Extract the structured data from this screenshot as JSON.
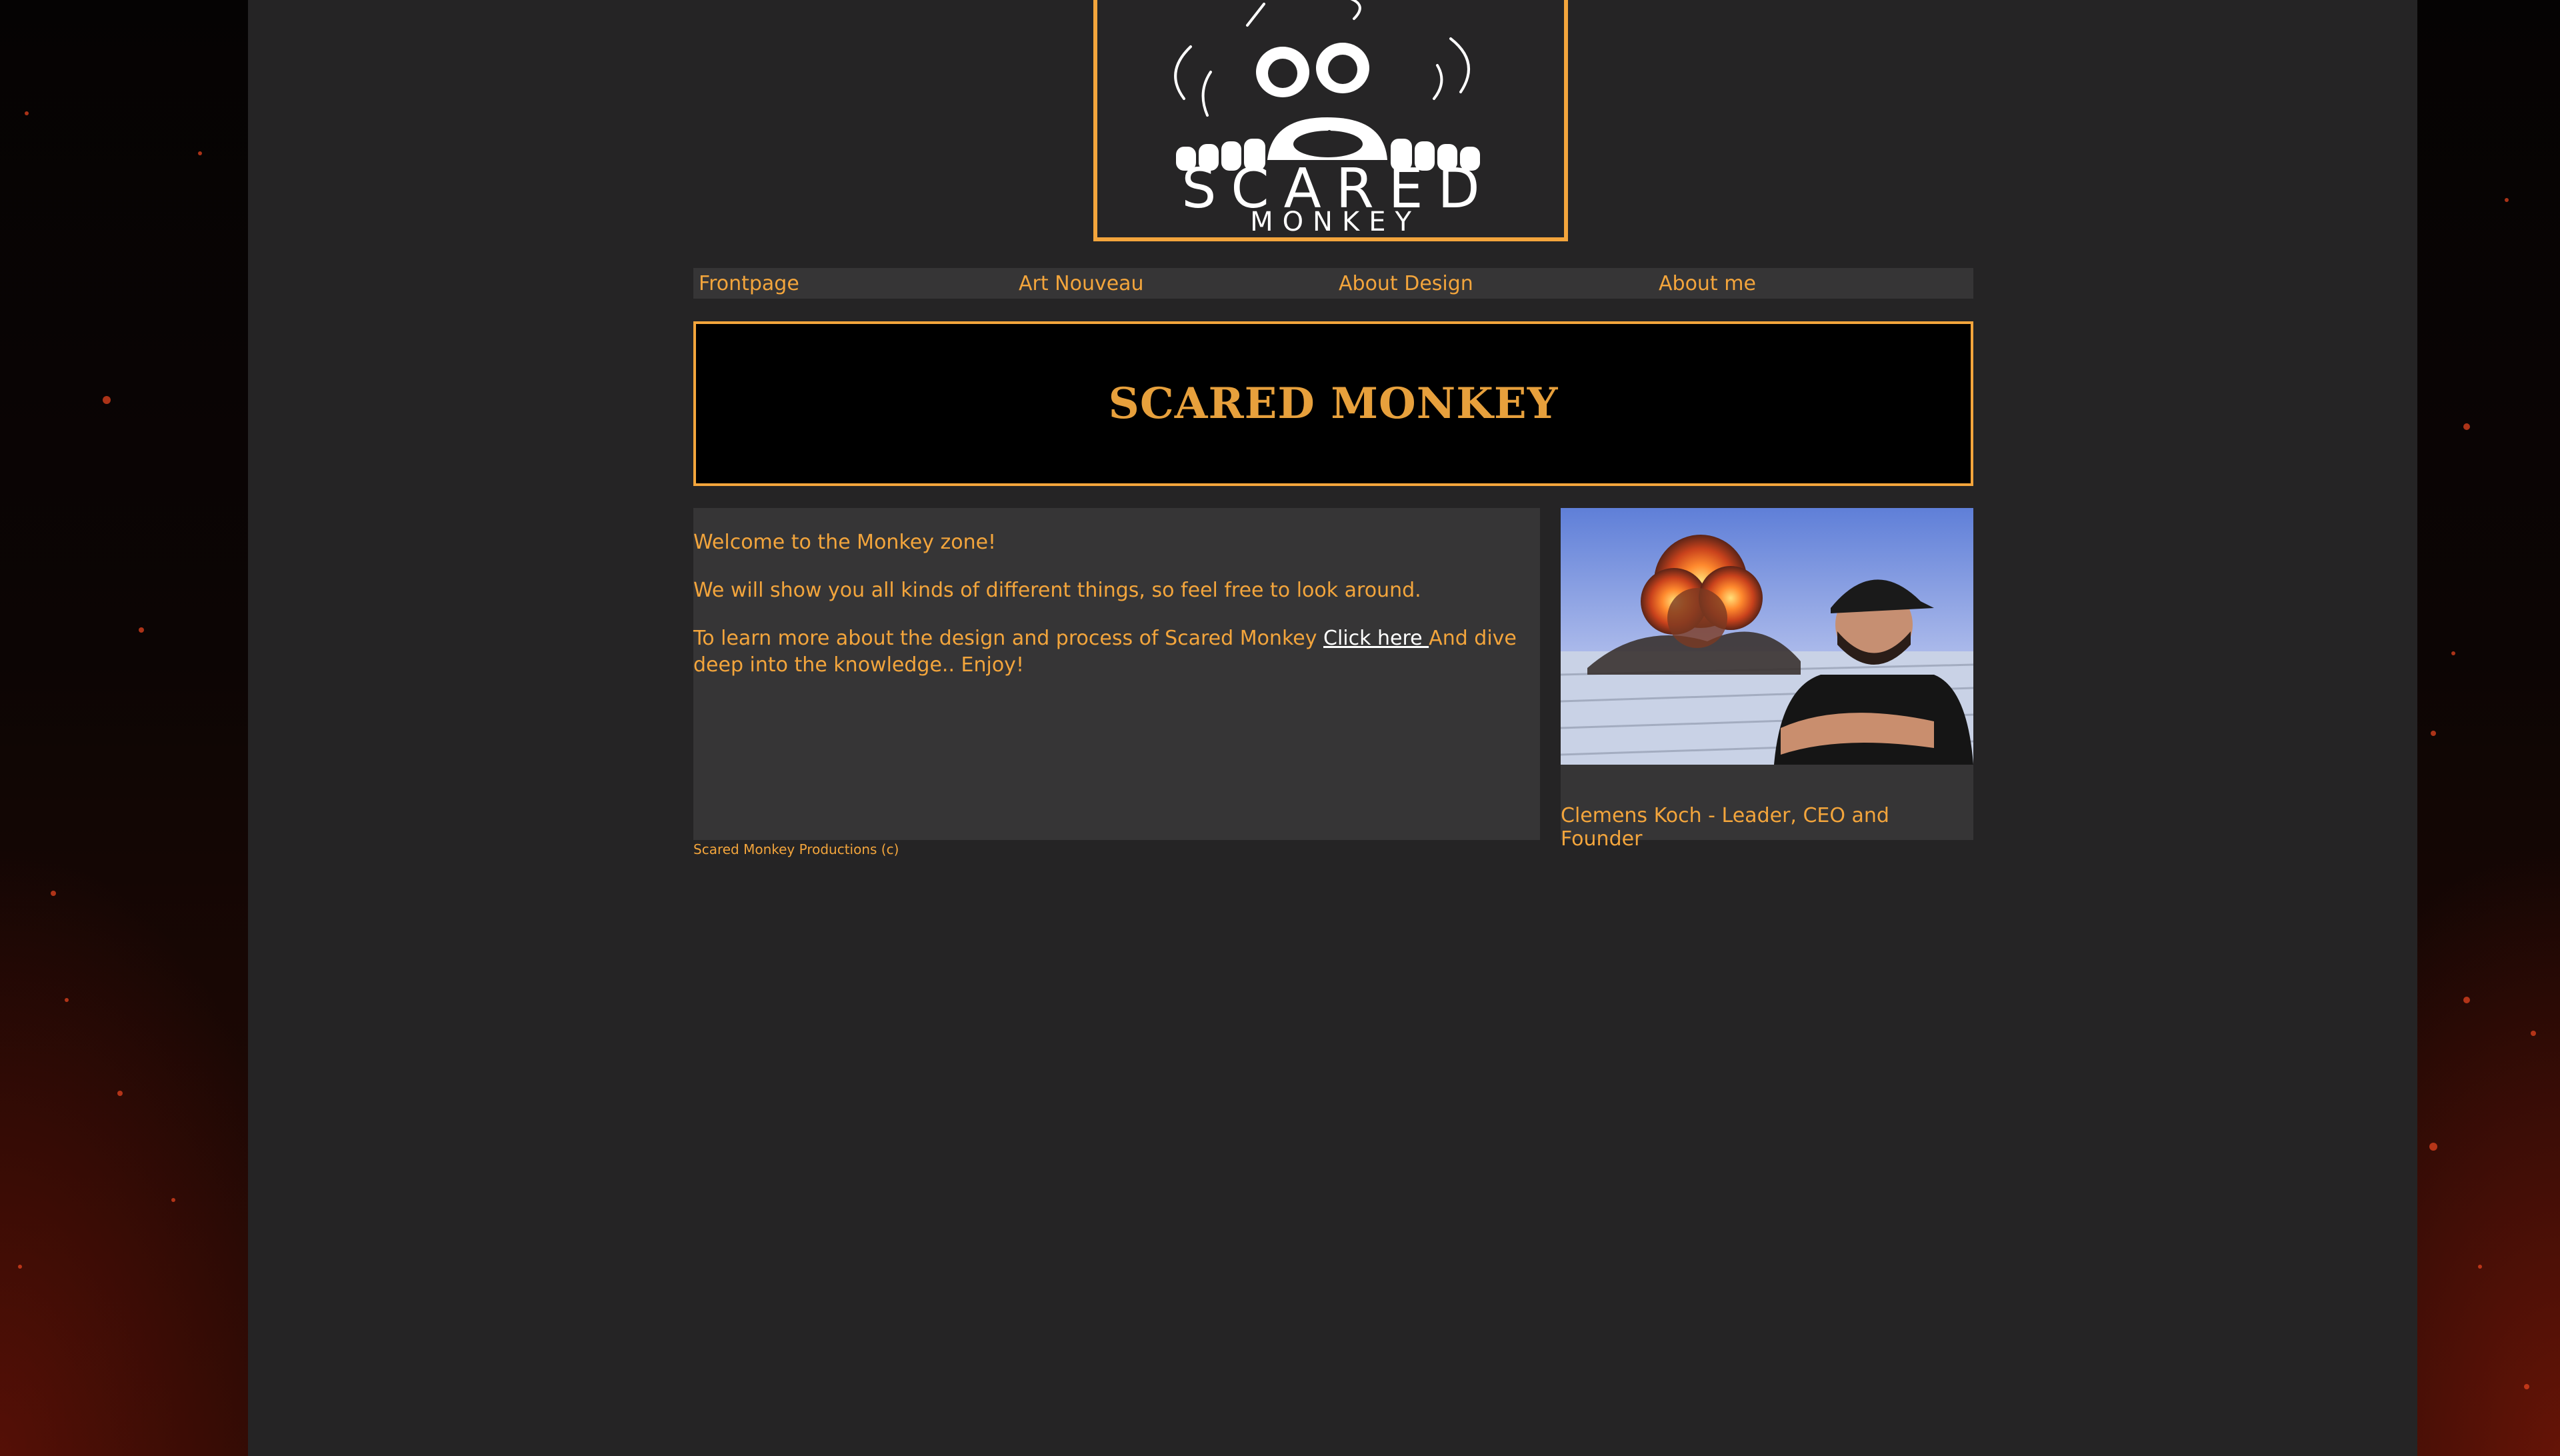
{
  "logo": {
    "title": "SCARED",
    "subtitle": "MONKEY"
  },
  "nav": {
    "items": [
      "Frontpage",
      "Art Nouveau",
      "About Design",
      "About me"
    ]
  },
  "banner": {
    "title": "SCARED MONKEY"
  },
  "welcome": {
    "line1": "Welcome to the Monkey zone!",
    "line2": "We will show you all kinds of different things, so feel free to look around.",
    "line3_before": "To learn more about the design and process of Scared Monkey ",
    "link_label": "Click here ",
    "line3_after": "And dive deep into the knowledge.. Enjoy!"
  },
  "footer": {
    "copyright": "Scared Monkey Productions (c)"
  },
  "profile": {
    "caption": "Clemens Koch - Leader, CEO and Founder"
  },
  "colors": {
    "accent": "#f3a53c",
    "panel": "#252425",
    "box": "#363536"
  }
}
